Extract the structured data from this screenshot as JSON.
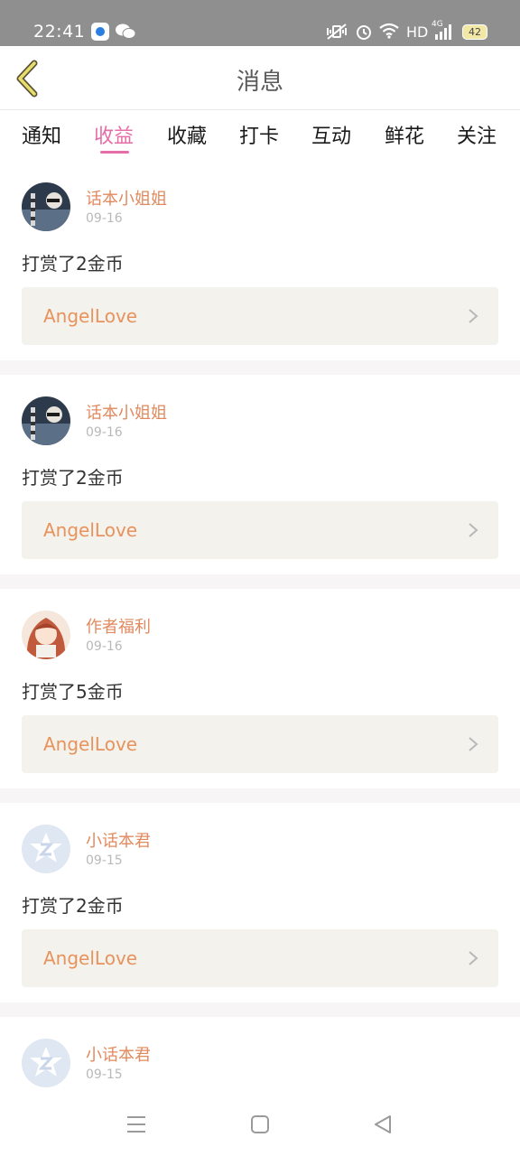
{
  "status_bar": {
    "time": "22:41",
    "network_label": "HD",
    "signal_label": "4G",
    "battery": "42"
  },
  "header": {
    "title": "消息",
    "back_icon": "chevron-left-icon"
  },
  "tabs": [
    {
      "label": "通知"
    },
    {
      "label": "收益"
    },
    {
      "label": "收藏"
    },
    {
      "label": "打卡"
    },
    {
      "label": "互动"
    },
    {
      "label": "鲜花"
    },
    {
      "label": "关注"
    }
  ],
  "active_tab": "收益",
  "messages": [
    {
      "name": "话本小姐姐",
      "date": "09-16",
      "text": "打赏了2金币",
      "link": "AngelLove",
      "avatar": "photo-avatar"
    },
    {
      "name": "话本小姐姐",
      "date": "09-16",
      "text": "打赏了2金币",
      "link": "AngelLove",
      "avatar": "photo-avatar"
    },
    {
      "name": "作者福利",
      "date": "09-16",
      "text": "打赏了5金币",
      "link": "AngelLove",
      "avatar": "anime-avatar"
    },
    {
      "name": "小话本君",
      "date": "09-15",
      "text": "打赏了2金币",
      "link": "AngelLove",
      "avatar": "logo-avatar"
    },
    {
      "name": "小话本君",
      "date": "09-15",
      "text": "",
      "link": "",
      "avatar": "logo-avatar"
    }
  ],
  "colors": {
    "accent_pink": "#e56ea8",
    "name_orange": "#e08a5e",
    "link_orange": "#e8925d",
    "link_bg": "#f3f2ec",
    "status_bar_bg": "#8f8f8f"
  },
  "nav_bar": [
    "menu-icon",
    "home-icon",
    "back-triangle-icon"
  ]
}
